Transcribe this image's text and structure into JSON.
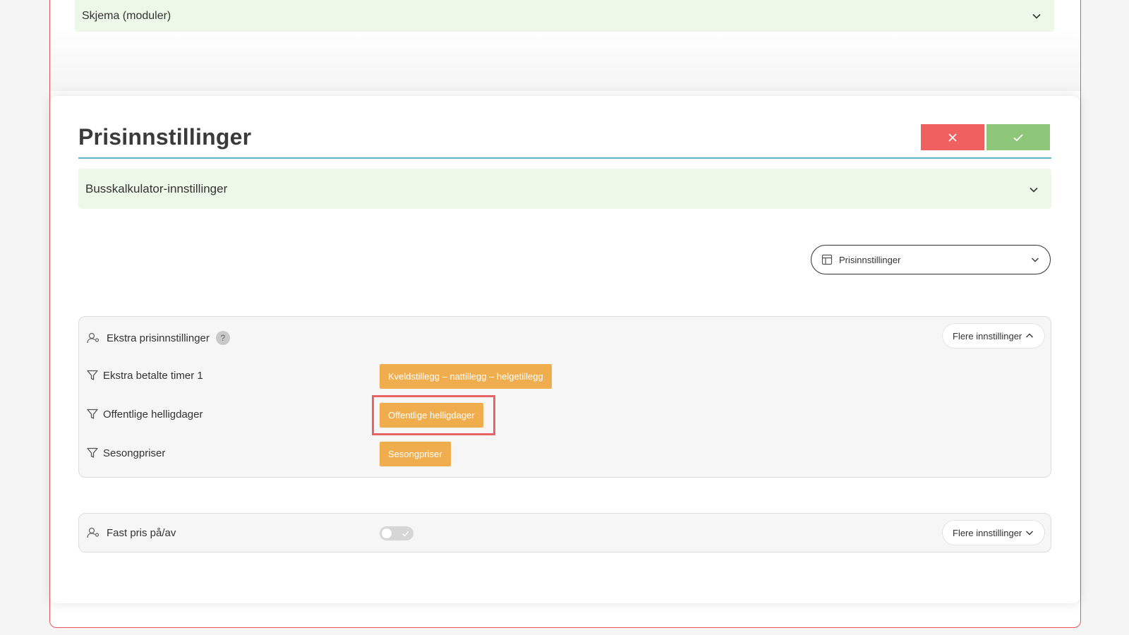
{
  "outer_accordion": {
    "label": "Skjema (moduler)"
  },
  "modal": {
    "title": "Prisinnstillinger",
    "cancel_icon": "close-icon",
    "confirm_icon": "check-icon",
    "accordion_label": "Busskalkulator-innstillinger",
    "view_select": {
      "icon": "table-icon",
      "value": "Prisinnstillinger"
    }
  },
  "extra_card": {
    "title": "Ekstra prisinnstillinger",
    "help": "?",
    "more_label": "Flere innstillinger",
    "rows": [
      {
        "label": "Ekstra betalte timer 1",
        "tag": "Kveldstillegg – nattillegg – helgetillegg"
      },
      {
        "label": "Offentlige helligdager",
        "tag": "Offentlige helligdager",
        "highlighted": true
      },
      {
        "label": "Sesongpriser",
        "tag": "Sesongpriser"
      }
    ]
  },
  "fixed_card": {
    "title": "Fast pris på/av",
    "toggle_on": false,
    "more_label": "Flere innstillinger"
  },
  "colors": {
    "accent_orange": "#f0ad4e",
    "cancel_red": "#f16060",
    "confirm_green": "#8ec67a",
    "header_line": "#5ab4d6",
    "accordion_bg": "#eef8e8",
    "highlight_border": "#e86464"
  }
}
